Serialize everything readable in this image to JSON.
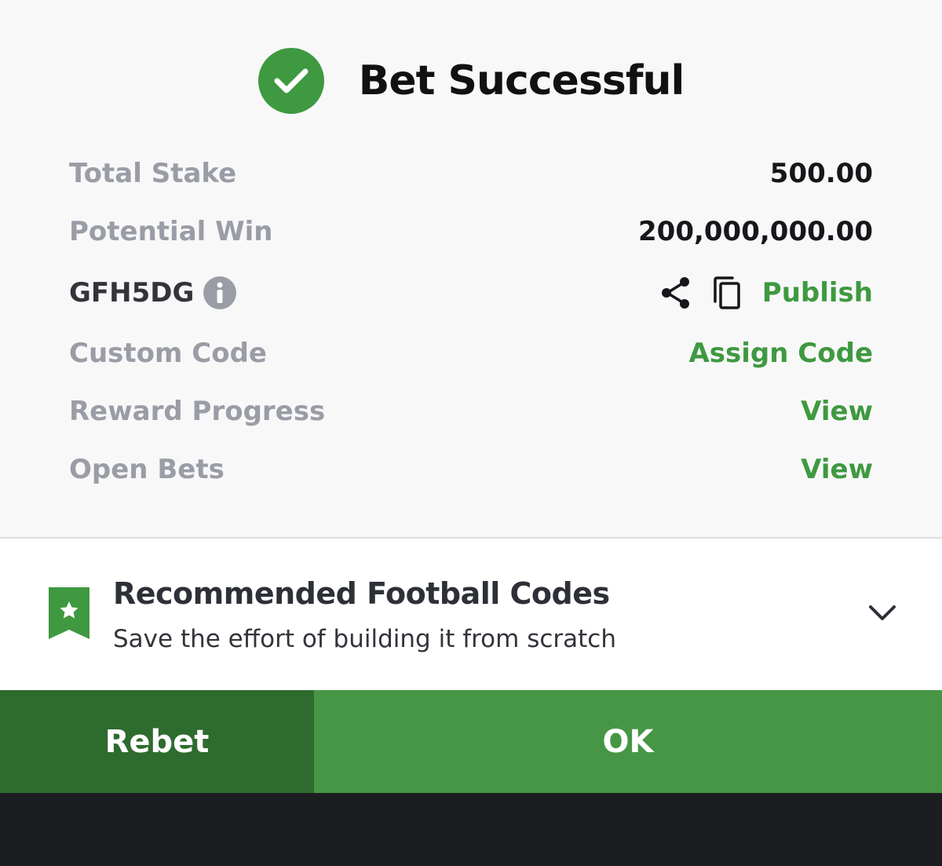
{
  "header": {
    "title": "Bet Successful",
    "icon": "check-circle-icon",
    "icon_color": "#3f9940"
  },
  "details": {
    "total_stake_label": "Total Stake",
    "total_stake_value": "500.00",
    "potential_win_label": "Potential Win",
    "potential_win_value": "200,000,000.00",
    "booking_code": "GFH5DG",
    "publish_label": "Publish",
    "custom_code_label": "Custom Code",
    "assign_code_label": "Assign Code",
    "reward_progress_label": "Reward Progress",
    "reward_progress_link": "View",
    "open_bets_label": "Open Bets",
    "open_bets_link": "View"
  },
  "recommendation": {
    "title": "Recommended Football Codes",
    "subtitle": "Save the effort of building it from scratch"
  },
  "buttons": {
    "rebet": "Rebet",
    "ok": "OK"
  },
  "colors": {
    "accent": "#3f9940",
    "rebet_bg": "#2e6b2e",
    "ok_bg": "#469645",
    "muted": "#9a9ca6"
  }
}
